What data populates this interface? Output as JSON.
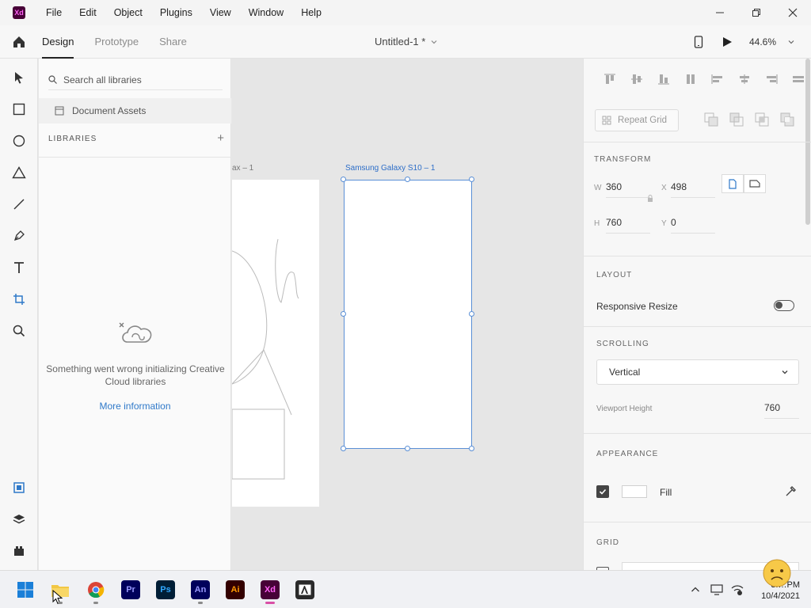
{
  "titlebar": {
    "logo_text": "Xd",
    "menu": [
      "File",
      "Edit",
      "Object",
      "Plugins",
      "View",
      "Window",
      "Help"
    ]
  },
  "appbar": {
    "tabs": [
      "Design",
      "Prototype",
      "Share"
    ],
    "document_title": "Untitled-1 *",
    "zoom": "44.6%"
  },
  "libraries": {
    "search_placeholder": "Search all libraries",
    "document_assets": "Document Assets",
    "header": "LIBRARIES",
    "add_symbol": "+",
    "error_message": "Something went wrong initializing Creative Cloud libraries",
    "more_info": "More information"
  },
  "canvas": {
    "artboard1_label": "ax – 1",
    "artboard2_label": "Samsung Galaxy S10 – 1"
  },
  "inspector": {
    "repeat_grid": "Repeat Grid",
    "transform": {
      "title": "TRANSFORM",
      "w_label": "W",
      "w_value": "360",
      "x_label": "X",
      "x_value": "498",
      "h_label": "H",
      "h_value": "760",
      "y_label": "Y",
      "y_value": "0"
    },
    "layout": {
      "title": "LAYOUT",
      "responsive_resize": "Responsive Resize",
      "responsive_on": false
    },
    "scrolling": {
      "title": "SCROLLING",
      "selected": "Vertical",
      "viewport_label": "Viewport Height",
      "viewport_value": "760"
    },
    "appearance": {
      "title": "APPEARANCE",
      "fill_label": "Fill",
      "fill_checked": true,
      "fill_color": "#FFFFFF"
    },
    "grid": {
      "title": "GRID"
    }
  },
  "taskbar": {
    "apps": [
      "Start",
      "File Explorer",
      "Chrome",
      "Pr",
      "Ps",
      "An",
      "Ai",
      "Xd",
      "Adobe"
    ],
    "time": "3:…PM",
    "date": "10/4/2021"
  },
  "colors": {
    "accent_blue": "#2F79C9",
    "selection_blue": "#5A8FD6",
    "xd_brand": "#470137",
    "xd_pink": "#FF61F6"
  }
}
